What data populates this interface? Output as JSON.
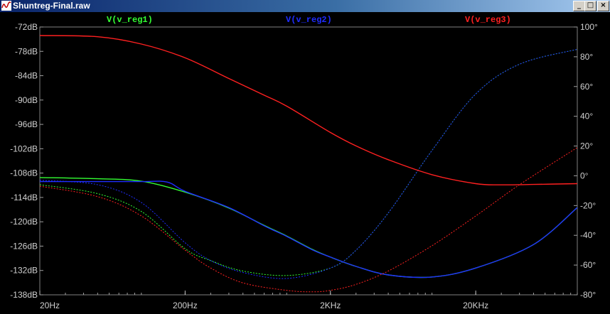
{
  "window": {
    "title": "Shuntreg-Final.raw",
    "buttons": {
      "minimize": "_",
      "maximize": "□",
      "close": "×"
    }
  },
  "colors": {
    "plot_bg": "#000000",
    "axis_text": "#d0d0d0",
    "v_reg1": "#33ff33",
    "v_reg2": "#1f2dff",
    "v_reg3": "#ff2020"
  },
  "chart_data": {
    "type": "line",
    "x_scale": "log",
    "xlim": [
      20,
      100000
    ],
    "y_left_lim": [
      -138,
      -72
    ],
    "y_right_lim": [
      -80,
      100
    ],
    "grid": false,
    "x_tick_labels": [
      "20Hz",
      "200Hz",
      "2KHz",
      "20KHz"
    ],
    "x_tick_values": [
      20,
      200,
      2000,
      20000
    ],
    "y_left_tick_labels": [
      "-72dB",
      "-78dB",
      "-84dB",
      "-90dB",
      "-96dB",
      "-102dB",
      "-108dB",
      "-114dB",
      "-120dB",
      "-126dB",
      "-132dB",
      "-138dB"
    ],
    "y_left_tick_values": [
      -72,
      -78,
      -84,
      -90,
      -96,
      -102,
      -108,
      -114,
      -120,
      -126,
      -132,
      -138
    ],
    "y_right_tick_labels": [
      "100°",
      "80°",
      "60°",
      "40°",
      "20°",
      "0°",
      "-20°",
      "-40°",
      "-60°",
      "-80°"
    ],
    "y_right_tick_values": [
      100,
      80,
      60,
      40,
      20,
      0,
      -20,
      -40,
      -60,
      -80
    ],
    "series": [
      {
        "name": "V(v_reg1)",
        "magnitude_db": {
          "x": [
            20,
            50,
            100,
            200,
            400,
            700,
            1000,
            1500,
            2000,
            3000,
            5000,
            10000,
            20000,
            50000,
            100000
          ],
          "y": [
            -109.1,
            -109.4,
            -110.0,
            -112.7,
            -116.6,
            -120.9,
            -123.5,
            -126.8,
            -128.7,
            -131.0,
            -133.1,
            -133.6,
            -131.4,
            -125.6,
            -116.5
          ]
        },
        "phase_deg": {
          "x": [
            20,
            50,
            100,
            200,
            300,
            500,
            1000,
            2000,
            3000,
            5000,
            10000,
            20000,
            40000,
            100000
          ],
          "y": [
            -6,
            -12,
            -24,
            -49,
            -57,
            -64,
            -67,
            -62,
            -50,
            -25,
            17,
            55,
            75,
            85
          ]
        }
      },
      {
        "name": "V(v_reg2)",
        "magnitude_db": {
          "x": [
            20,
            50,
            100,
            150,
            200,
            400,
            700,
            1000,
            1500,
            2000,
            3000,
            5000,
            10000,
            20000,
            50000,
            100000
          ],
          "y": [
            -110.1,
            -110.1,
            -110.1,
            -110.2,
            -112.5,
            -116.5,
            -121.0,
            -123.6,
            -126.9,
            -128.7,
            -131.0,
            -133.1,
            -133.6,
            -131.4,
            -125.6,
            -116.5
          ]
        },
        "phase_deg": {
          "x": [
            20,
            50,
            100,
            200,
            300,
            500,
            1000,
            2000,
            3000,
            5000,
            10000,
            20000,
            40000,
            100000
          ],
          "y": [
            -3,
            -6,
            -18,
            -45,
            -57,
            -65,
            -69,
            -62,
            -50,
            -25,
            17,
            55,
            75,
            85
          ]
        }
      },
      {
        "name": "V(v_reg3)",
        "magnitude_db": {
          "x": [
            20,
            50,
            100,
            200,
            400,
            700,
            1000,
            2000,
            3000,
            5000,
            10000,
            20000,
            30000,
            50000,
            100000
          ],
          "y": [
            -74.1,
            -74.4,
            -76.2,
            -79.6,
            -84.7,
            -88.8,
            -91.5,
            -98.0,
            -101.3,
            -104.7,
            -108.4,
            -110.6,
            -110.9,
            -110.8,
            -110.6
          ]
        },
        "phase_deg": {
          "x": [
            20,
            50,
            100,
            200,
            300,
            500,
            1000,
            1500,
            2000,
            3000,
            5000,
            10000,
            20000,
            40000,
            100000
          ],
          "y": [
            -7,
            -14,
            -27,
            -50,
            -62,
            -72,
            -77,
            -78,
            -77,
            -73,
            -64,
            -47,
            -27,
            -6,
            19
          ]
        }
      }
    ]
  }
}
